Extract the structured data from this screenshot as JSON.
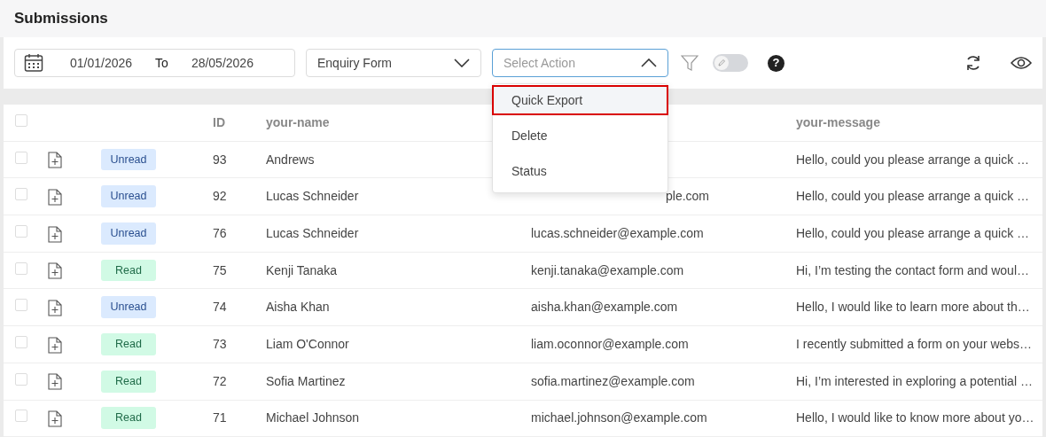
{
  "page_title": "Submissions",
  "toolbar": {
    "date_from": "01/01/2026",
    "date_separator": "To",
    "date_to": "28/05/2026",
    "form_select": "Enquiry Form",
    "action_select": {
      "placeholder": "Select Action",
      "expanded": true
    },
    "edit_toggle": {
      "on": false
    },
    "help_label": "?"
  },
  "action_menu": [
    {
      "label": "Quick Export",
      "highlighted": true
    },
    {
      "label": "Delete",
      "highlighted": false
    },
    {
      "label": "Status",
      "highlighted": false
    }
  ],
  "table": {
    "all_checked": false,
    "columns": [
      "ID",
      "your-name",
      "your-message"
    ],
    "rows": [
      {
        "checked": false,
        "status": "Unread",
        "kind": "unread",
        "id": "93",
        "name": "Andrews",
        "message": "Hello, could you please arrange a quick …"
      },
      {
        "checked": false,
        "status": "Unread",
        "kind": "unread",
        "id": "92",
        "name": "Lucas Schneider",
        "email": "ple.com",
        "email_partial": true,
        "message": "Hello, could you please arrange a quick …"
      },
      {
        "checked": false,
        "status": "Unread",
        "kind": "unread",
        "id": "76",
        "name": "Lucas Schneider",
        "email": "lucas.schneider@example.com",
        "message": "Hello, could you please arrange a quick …"
      },
      {
        "checked": false,
        "status": "Read",
        "kind": "read",
        "id": "75",
        "name": "Kenji Tanaka",
        "email": "kenji.tanaka@example.com",
        "message": "Hi, I’m testing the contact form and woul…"
      },
      {
        "checked": false,
        "status": "Unread",
        "kind": "unread",
        "id": "74",
        "name": "Aisha Khan",
        "email": "aisha.khan@example.com",
        "message": "Hello, I would like to learn more about th…"
      },
      {
        "checked": false,
        "status": "Read",
        "kind": "read",
        "id": "73",
        "name": "Liam O'Connor",
        "email": "liam.oconnor@example.com",
        "message": "I recently submitted a form on your webs…"
      },
      {
        "checked": false,
        "status": "Read",
        "kind": "read",
        "id": "72",
        "name": "Sofia Martinez",
        "email": "sofia.martinez@example.com",
        "message": "Hi, I’m interested in exploring a potential …"
      },
      {
        "checked": false,
        "status": "Read",
        "kind": "read",
        "id": "71",
        "name": "Michael Johnson",
        "email": "michael.johnson@example.com",
        "message": "Hello, I would like to know more about yo…"
      }
    ]
  }
}
